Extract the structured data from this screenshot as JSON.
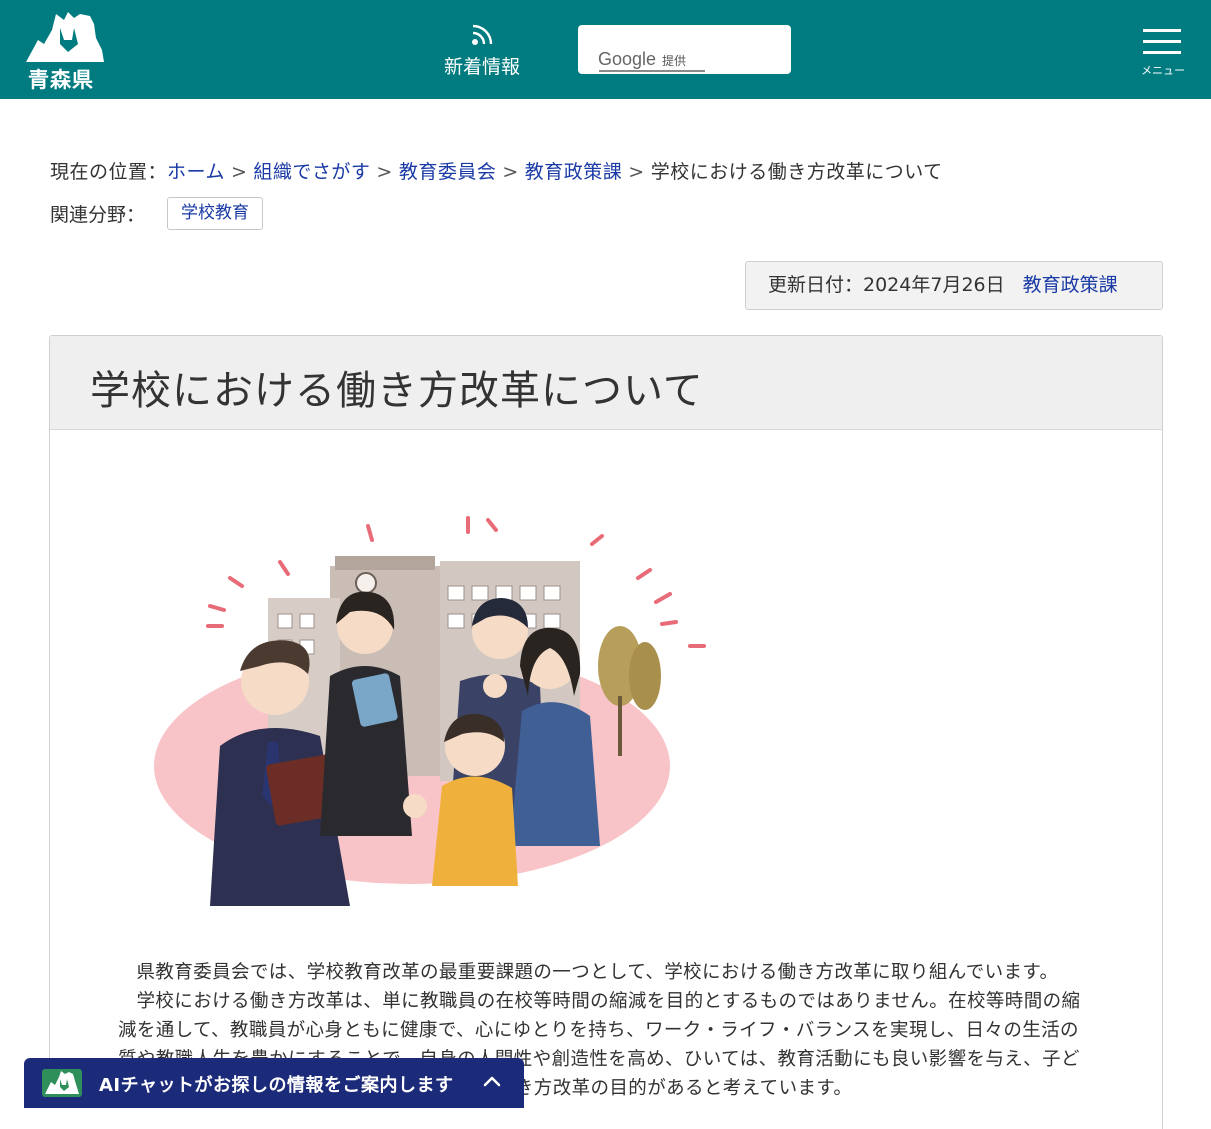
{
  "header": {
    "logo_text": "青森県",
    "news_label": "新着情報",
    "search": {
      "placeholder": "",
      "brand": "Google",
      "brand_sub": "提供"
    },
    "menu_label": "メニュー"
  },
  "breadcrumb": {
    "prefix": "現在の位置：",
    "items": [
      "ホーム",
      "組織でさがす",
      "教育委員会",
      "教育政策課"
    ],
    "separator": ">",
    "current": "学校における働き方改革について"
  },
  "related": {
    "label": "関連分野：",
    "tag": "学校教育"
  },
  "update": {
    "date_text": "更新日付：2024年7月26日",
    "department": "教育政策課"
  },
  "article": {
    "title": "学校における働き方改革について",
    "paragraphs": [
      "県教育委員会では、学校教育改革の最重要課題の一つとして、学校における働き方改革に取り組んでいます。",
      "学校における働き方改革は、単に教職員の在校等時間の縮減を目的とするものではありません。在校等時間の縮減を通して、教職員が心身ともに健康で、心にゆとりを持ち、ワーク・ライフ・バランスを実現し、日々の生活の質や教職人生を豊かにすることで、自身の人間性や創造性を高め、ひいては、教育活動にも良い影響を与え、子どもたちの成長につながることに学校における働き方改革の目的があると考えています。"
    ]
  },
  "chat": {
    "label": "AIチャットがお探しの情報をご案内します"
  },
  "colors": {
    "header_bg": "#007b80",
    "link": "#1a3aa6",
    "chat_bg": "#1c2a7a"
  }
}
